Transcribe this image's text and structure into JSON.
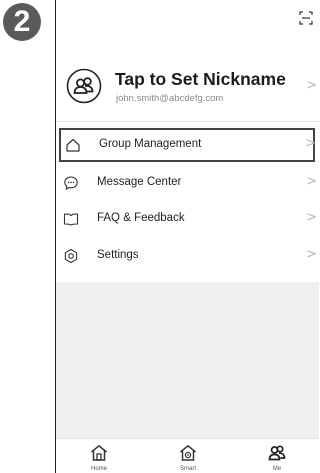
{
  "step_badge": "2",
  "profile": {
    "nickname": "Tap to Set Nickname",
    "email": "john.smith@abcdefg.com",
    "chevron": ">"
  },
  "menu": [
    {
      "label": "Group Management",
      "icon": "home-outline-icon",
      "chevron": ">"
    },
    {
      "label": "Message Center",
      "icon": "chat-bubble-icon",
      "chevron": ">"
    },
    {
      "label": "FAQ & Feedback",
      "icon": "book-icon",
      "chevron": ">"
    },
    {
      "label": "Settings",
      "icon": "hexagon-gear-icon",
      "chevron": ">"
    }
  ],
  "tabs": [
    {
      "label": "Home",
      "icon": "home-icon"
    },
    {
      "label": "Smart",
      "icon": "smart-house-icon"
    },
    {
      "label": "Me",
      "icon": "users-icon"
    }
  ],
  "colors": {
    "badge": "#5a5a5a",
    "background": "#ffffff",
    "gray_area": "#efefef",
    "text": "#1f1f1f",
    "secondary_text": "#8a8a8a"
  }
}
